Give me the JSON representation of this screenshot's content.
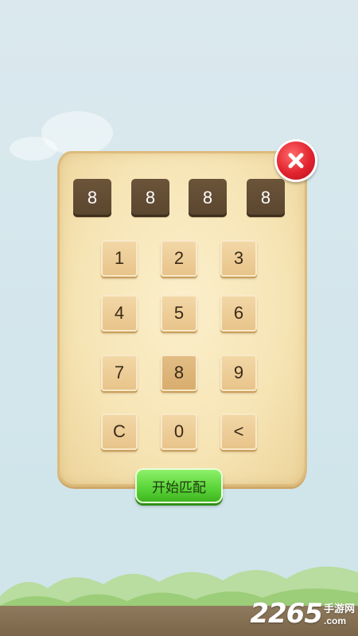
{
  "code_slots": [
    "8",
    "8",
    "8",
    "8"
  ],
  "keypad": {
    "keys": [
      "1",
      "2",
      "3",
      "4",
      "5",
      "6",
      "7",
      "8",
      "9",
      "C",
      "0",
      "<"
    ],
    "pressed_key": "8"
  },
  "start_button": {
    "label": "开始匹配"
  },
  "close_button": {
    "icon": "close-x-icon"
  },
  "watermark": {
    "number": "2265",
    "site_cn": "手游网",
    "domain": ".com"
  },
  "colors": {
    "board": "#f6e4b4",
    "slot": "#5f4a32",
    "key": "#ebc98f",
    "start": "#5cd63a",
    "close": "#e2232f"
  }
}
